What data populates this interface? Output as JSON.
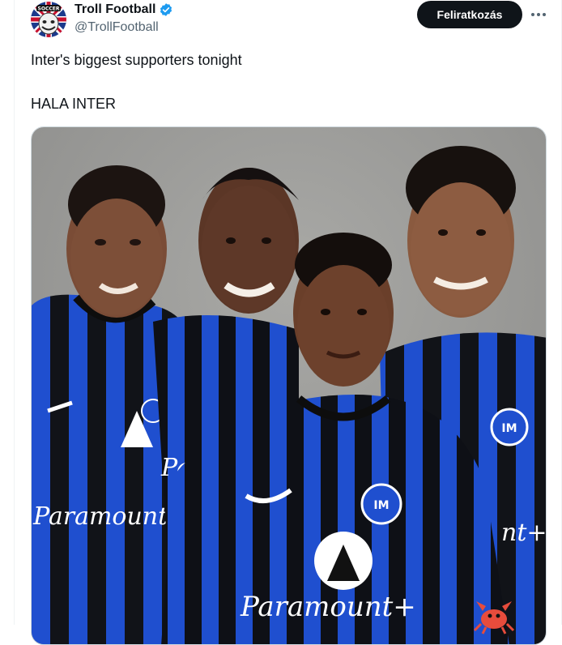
{
  "tweet": {
    "display_name": "Troll Football",
    "handle": "@TrollFootball",
    "subscribe_label": "Feliratkozás",
    "text_line1": "Inter's biggest supporters tonight",
    "text_line2": "HALA INTER",
    "avatar_badge_text": "SOCCER"
  },
  "media": {
    "shirt_sponsor": "Paramount+",
    "sponsor_partial_left": "Paramount",
    "sponsor_partial_right": "nt+",
    "sponsor_partial_mid": "Pa",
    "crest_text": "IM"
  },
  "colors": {
    "verified": "#1d9bf0",
    "button_bg": "#0f1419",
    "inter_blue": "#1f4fcf",
    "inter_black": "#111318"
  },
  "icons": [
    "verified-badge-icon",
    "more-icon",
    "crab-emoji-icon"
  ]
}
